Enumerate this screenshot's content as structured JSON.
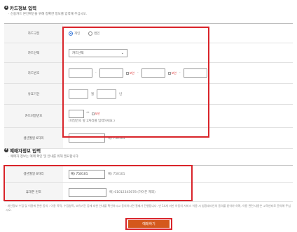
{
  "card_section": {
    "number": "1",
    "title": "카드정보 입력",
    "desc": "· 신용카드 본인확인을 위해 정확한 정보를 입력해 주십시오.",
    "rows": {
      "type": {
        "label": "카드구분",
        "opt1": "개인",
        "opt2": "법인"
      },
      "select": {
        "label": "카드선택",
        "value": "카드선택"
      },
      "number": {
        "label": "카드번호",
        "dash": "-",
        "check1": "보안",
        "check2": "보안"
      },
      "expiry": {
        "label": "유효기간",
        "month": "월",
        "year": "년"
      },
      "password": {
        "label": "카드비밀번호",
        "mask": "**",
        "check": "보안",
        "hint": "(비밀번호 앞 2자리를 입력하세요.)"
      },
      "birth": {
        "label": "생년월일 6자리",
        "example": "예) 750101"
      }
    }
  },
  "extra_section": {
    "number": "2",
    "title": "예매자정보 입력",
    "desc": "· 예매자 정보는 예매 확인 및 안내를 위해 필요합니다.",
    "rows": {
      "birth": {
        "label": "생년월일 6자리",
        "value": "예) 750101",
        "example": "예) 750101"
      },
      "phone": {
        "label": "휴대폰 번호",
        "example": "예) 01012345678 (하이픈 제외)"
      }
    }
  },
  "notice": "· 개인정보 수집 및 이용에 관한 동의 : 이용 목적, 수집항목, 보유기간 등에 대한 안내를 확인하시고 동의하시면 결제가 진행됩니다. 만 14세 미만 아동의 서비스 이용 시 법정대리인의 동의를 받아야 하며, 이용 관련 내용은 고객센터로 문의해 주십시오.",
  "submit_label": "예매하기"
}
